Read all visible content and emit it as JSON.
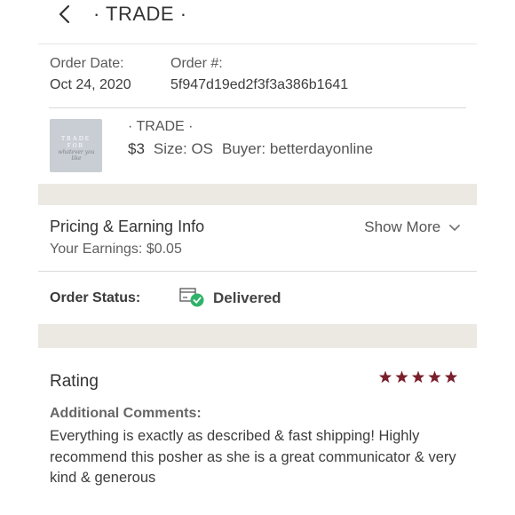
{
  "header": {
    "title": "· TRADE ·",
    "back_icon": "chevron-left-icon"
  },
  "order_meta": {
    "date_label": "Order Date:",
    "date_value": "Oct 24, 2020",
    "number_label": "Order #:",
    "number_value": "5f947d19ed2f3f3a386b1641"
  },
  "item": {
    "name": "· TRADE ·",
    "price": "$3",
    "size": "Size: OS",
    "buyer": "Buyer: betterdayonline",
    "thumbnail": {
      "line1": "TRADE",
      "line2": "FOR",
      "line3": "whatever you like"
    }
  },
  "pricing": {
    "heading": "Pricing & Earning Info",
    "earnings": "Your Earnings: $0.05",
    "show_more": "Show More"
  },
  "status": {
    "label": "Order Status:",
    "value": "Delivered",
    "icon": "delivered-box-check-icon"
  },
  "rating": {
    "heading": "Rating",
    "stars": 5,
    "star_color": "#7a1f2b",
    "comments_label": "Additional Comments:",
    "comment": "Everything is exactly as described & fast shipping! Highly recommend this posher as she is a great communicator & very kind & generous"
  },
  "colors": {
    "separator": "#ece9e3",
    "check_green": "#2fb36b"
  }
}
